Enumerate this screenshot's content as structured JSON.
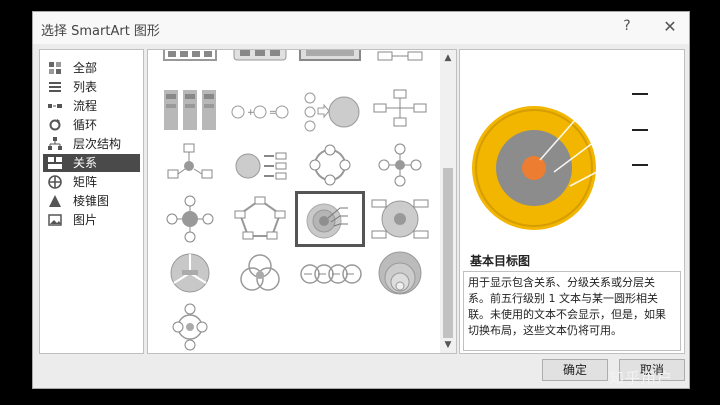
{
  "dialog": {
    "title": "选择 SmartArt 图形",
    "help": "?",
    "close": "✕"
  },
  "categories": [
    {
      "label": "全部",
      "icon": "all-icon"
    },
    {
      "label": "列表",
      "icon": "list-icon"
    },
    {
      "label": "流程",
      "icon": "process-icon"
    },
    {
      "label": "循环",
      "icon": "cycle-icon"
    },
    {
      "label": "层次结构",
      "icon": "hierarchy-icon"
    },
    {
      "label": "关系",
      "icon": "relationship-icon",
      "selected": true
    },
    {
      "label": "矩阵",
      "icon": "matrix-icon"
    },
    {
      "label": "棱锥图",
      "icon": "pyramid-icon"
    },
    {
      "label": "图片",
      "icon": "picture-icon"
    }
  ],
  "preview": {
    "title": "基本目标图",
    "description": "用于显示包含关系、分级关系或分层关系。前五行级别 1 文本与某一圆形相关联。未使用的文本不会显示，但是，如果切换布局，这些文本仍将可用。",
    "colors": {
      "outer": "#f2b500",
      "middle": "#8c8c8c",
      "center": "#ed7d31"
    }
  },
  "buttons": {
    "ok": "确定",
    "cancel": "取消"
  },
  "watermark": "知乎用户"
}
